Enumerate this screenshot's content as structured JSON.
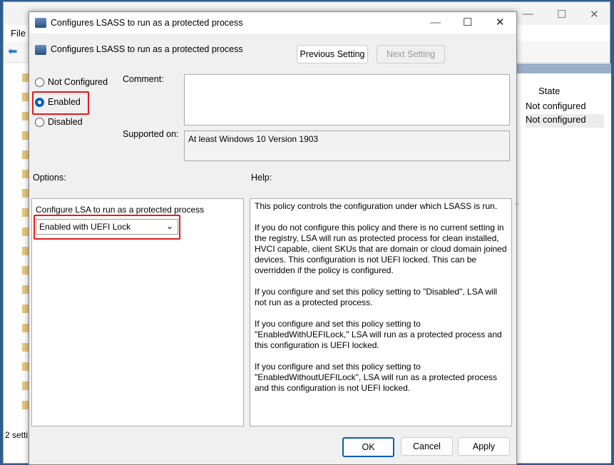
{
  "background": {
    "menu_file": "File",
    "column_state": "State",
    "rows": [
      "Not configured",
      "Not configured"
    ],
    "status": "2 setti"
  },
  "dialog": {
    "title": "Configures LSASS to run as a protected process",
    "header": "Configures LSASS to run as a protected process",
    "prev": "Previous Setting",
    "next": "Next Setting",
    "radios": {
      "not_configured": "Not Configured",
      "enabled": "Enabled",
      "disabled": "Disabled",
      "selected": "Enabled"
    },
    "comment_label": "Comment:",
    "comment_value": "",
    "supported_label": "Supported on:",
    "supported_value": "At least Windows 10 Version 1903",
    "options_label": "Options:",
    "help_label": "Help:",
    "option_name": "Configure LSA to run as a protected process",
    "option_value": "Enabled with UEFI Lock",
    "help": [
      "This policy controls the configuration under which LSASS is run.",
      "If you do not configure this policy and there is no current setting in the registry, LSA will run as protected process for clean installed, HVCI capable, client SKUs that are domain or cloud domain joined devices. This configuration is not UEFI locked. This can be overridden if the policy is configured.",
      "If you configure and set this policy setting to \"Disabled\", LSA will not run as a protected process.",
      "If you configure and set this policy setting to \"EnabledWithUEFILock,\" LSA will run as a protected process and this configuration is UEFI locked.",
      "If you configure and set this policy setting to \"EnabledWithoutUEFILock\", LSA will run as a protected process and this configuration is not UEFI locked."
    ],
    "ok": "OK",
    "cancel": "Cancel",
    "apply": "Apply"
  },
  "colors": {
    "highlight": "#e51a1a",
    "accent": "#0a5cba"
  }
}
